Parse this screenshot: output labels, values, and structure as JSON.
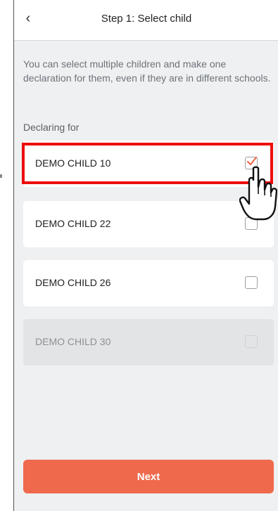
{
  "header": {
    "back_icon": "chevron-left-icon",
    "title": "Step 1: Select child"
  },
  "intro_text": "You can select multiple children and make one declaration for them, even if they are in different schools.",
  "section_label": "Declaring for",
  "children": [
    {
      "name": "DEMO CHILD 10",
      "checked": true,
      "disabled": false
    },
    {
      "name": "DEMO CHILD 22",
      "checked": false,
      "disabled": false
    },
    {
      "name": "DEMO CHILD 26",
      "checked": false,
      "disabled": false
    },
    {
      "name": "DEMO CHILD 30",
      "checked": false,
      "disabled": true
    }
  ],
  "next_label": "Next",
  "colors": {
    "accent": "#ef6a4c",
    "highlight": "#ee0d0d",
    "background": "#eef0f2"
  }
}
